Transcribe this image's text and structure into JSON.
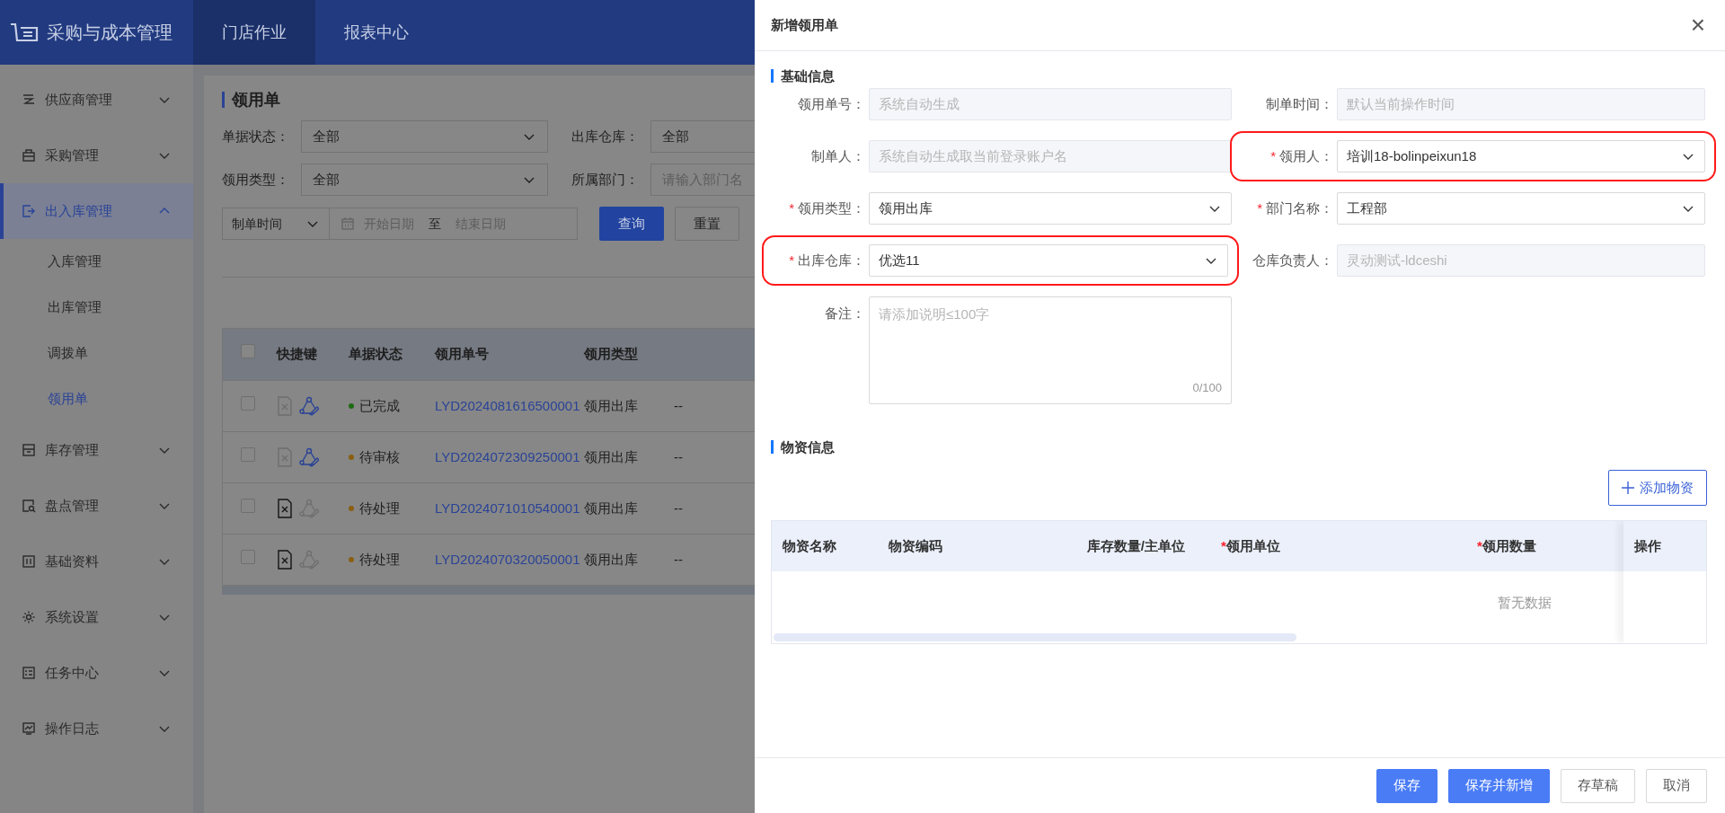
{
  "app": {
    "title": "采购与成本管理",
    "top_tabs": [
      {
        "label": "门店作业",
        "selected": true
      },
      {
        "label": "报表中心",
        "selected": false
      }
    ]
  },
  "sidebar": {
    "items": [
      {
        "label": "供应商管理",
        "expanded": false,
        "selected": false
      },
      {
        "label": "采购管理",
        "expanded": false,
        "selected": false
      },
      {
        "label": "出入库管理",
        "expanded": true,
        "selected": true,
        "children": [
          {
            "label": "入库管理",
            "selected": false
          },
          {
            "label": "出库管理",
            "selected": false
          },
          {
            "label": "调拨单",
            "selected": false
          },
          {
            "label": "领用单",
            "selected": true
          }
        ]
      },
      {
        "label": "库存管理",
        "expanded": false,
        "selected": false
      },
      {
        "label": "盘点管理",
        "expanded": false,
        "selected": false
      },
      {
        "label": "基础资料",
        "expanded": false,
        "selected": false
      },
      {
        "label": "系统设置",
        "expanded": false,
        "selected": false
      },
      {
        "label": "任务中心",
        "expanded": false,
        "selected": false
      },
      {
        "label": "操作日志",
        "expanded": false,
        "selected": false
      }
    ]
  },
  "page": {
    "title": "领用单",
    "filters": [
      {
        "label": "单据状态：",
        "value": "全部"
      },
      {
        "label": "出库仓库：",
        "value": "全部"
      },
      {
        "label": "领用类型：",
        "value": "全部"
      },
      {
        "label": "所属部门：",
        "placeholder": "请输入部门名"
      }
    ],
    "date_filter": {
      "field": "制单时间",
      "start_placeholder": "开始日期",
      "separator": "至",
      "end_placeholder": "结束日期"
    },
    "buttons": [
      "查询",
      "重置"
    ],
    "table": {
      "select_all_checked": false,
      "columns": [
        "快捷键",
        "单据状态",
        "领用单号",
        "领用类型"
      ],
      "rows": [
        {
          "checked": false,
          "void_disabled": true,
          "edit_disabled": false,
          "status": "已完成",
          "color": "#1e6b14",
          "number": "LYD2024081616500001",
          "type": "领用出库",
          "column_6": "--"
        },
        {
          "checked": false,
          "void_disabled": true,
          "edit_disabled": false,
          "status": "待审核",
          "color": "#8a5f10",
          "number": "LYD2024072309250001",
          "type": "领用出库",
          "column_6": "--"
        },
        {
          "checked": false,
          "void_disabled": false,
          "edit_disabled": true,
          "status": "待处理",
          "color": "#8a5f10",
          "number": "LYD2024071010540001",
          "type": "领用出库",
          "column_6": "--"
        },
        {
          "checked": false,
          "void_disabled": false,
          "edit_disabled": true,
          "status": "待处理",
          "color": "#8a5f10",
          "number": "LYD2024070320050001",
          "type": "领用出库",
          "column_6": "--"
        }
      ]
    }
  },
  "drawer": {
    "title": "新增领用单",
    "close": "×",
    "basic_section": "基础信息",
    "fields": [
      {
        "label": "领用单号：",
        "kind": "input",
        "disabled": true,
        "placeholder": "系统自动生成",
        "highlighted": false
      },
      {
        "label": "制单时间：",
        "kind": "input",
        "disabled": true,
        "placeholder": "默认当前操作时间",
        "highlighted": false
      },
      {
        "label": "制单人：",
        "kind": "input",
        "disabled": true,
        "placeholder": "系统自动生成取当前登录账户名",
        "highlighted": false
      },
      {
        "required_mark": "*",
        "label": "领用人：",
        "kind": "select",
        "value": "培训18-bolinpeixun18",
        "highlighted": true
      },
      {
        "required_mark": "*",
        "label": "领用类型：",
        "kind": "select",
        "value": "领用出库",
        "highlighted": false
      },
      {
        "required_mark": "*",
        "label": "部门名称：",
        "kind": "select",
        "value": "工程部",
        "highlighted": false
      },
      {
        "required_mark": "*",
        "label": "出库仓库：",
        "kind": "select",
        "value": "优选11",
        "highlighted": true
      },
      {
        "label": "仓库负责人：",
        "kind": "input",
        "disabled": true,
        "placeholder": "灵动测试-ldceshi",
        "highlighted": false
      },
      {
        "label": "备注：",
        "kind": "textarea",
        "placeholder": "请添加说明≤100字",
        "counter": "0/100",
        "highlighted": false
      }
    ],
    "materials_section": "物资信息",
    "add_button": "添加物资",
    "table": {
      "columns": [
        {
          "label": "物资名称"
        },
        {
          "label": "物资编码"
        },
        {
          "label": "库存数量/主单位"
        },
        {
          "required_mark": "*",
          "label": "领用单位"
        },
        {
          "required_mark": "*",
          "label": "领用数量"
        }
      ],
      "action_column": "操作",
      "empty_text": "暂无数据"
    },
    "footer_buttons": [
      {
        "label": "保存",
        "kind": "primary"
      },
      {
        "label": "保存并新增",
        "kind": "primary"
      },
      {
        "label": "存草稿",
        "kind": "default"
      },
      {
        "label": "取消",
        "kind": "default"
      }
    ]
  }
}
